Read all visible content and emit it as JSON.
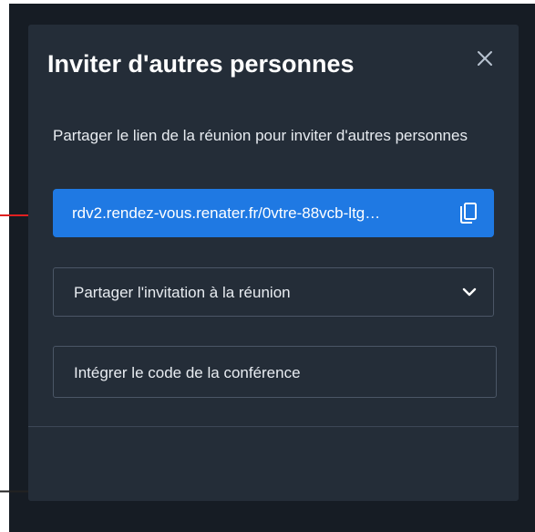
{
  "dialog": {
    "title": "Inviter d'autres personnes",
    "description": "Partager le lien de la réunion pour inviter d'autres personnes",
    "meeting_link": "rdv2.rendez-vous.renater.fr/0vtre-88vcb-ltg…",
    "share_invitation_label": "Partager l'invitation à la réunion",
    "embed_label": "Intégrer le code de la conférence"
  },
  "icons": {
    "close": "close-icon",
    "copy": "copy-icon",
    "dropdown": "chevron-down-icon"
  },
  "colors": {
    "backdrop": "#161c24",
    "dialog_background": "#242d38",
    "link_box": "#1f79e3",
    "annotation_arrow": "#e02020",
    "border": "#4b5666"
  }
}
